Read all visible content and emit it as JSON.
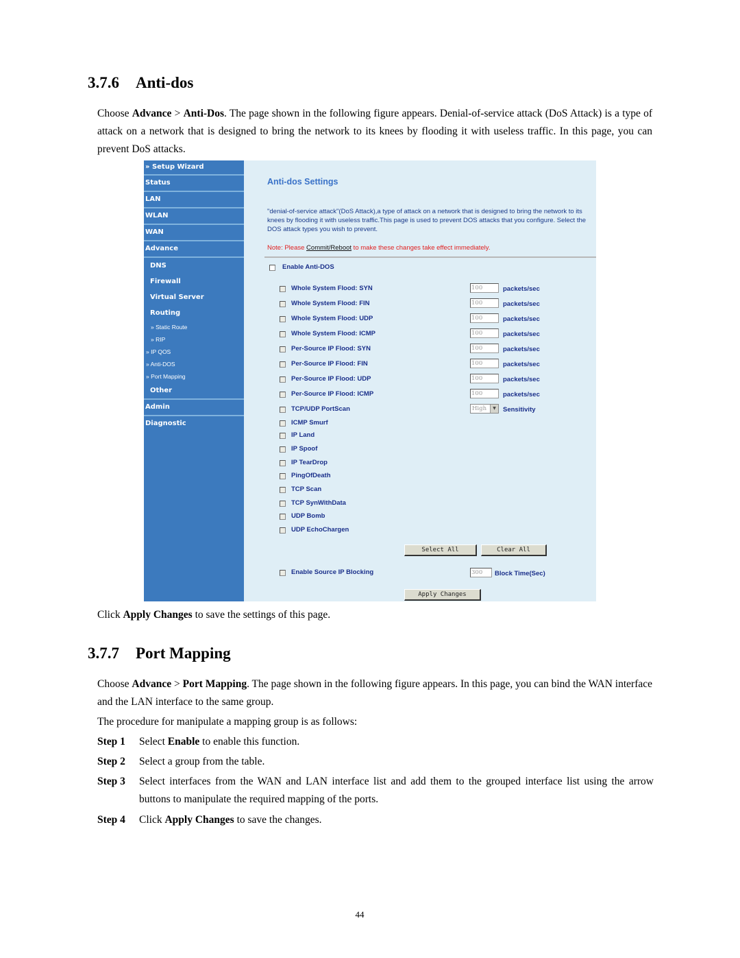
{
  "section1": {
    "number": "3.7.6",
    "title": "Anti-dos",
    "intro": {
      "pre": "Choose ",
      "b1": "Advance",
      "mid": " > ",
      "b2": "Anti-Dos",
      "post": ". The page shown in the following figure appears. Denial-of-service attack (DoS Attack) is a type of attack on a network that is designed to bring the network to its knees by flooding it with useless traffic. In this page, you can prevent DoS attacks."
    },
    "after": {
      "pre": "Click ",
      "b": "Apply Changes",
      "post": " to save the settings of this page."
    }
  },
  "figure": {
    "sidebar": {
      "items": [
        {
          "label": "» Setup Wizard"
        },
        {
          "label": "Status"
        },
        {
          "label": "LAN"
        },
        {
          "label": "WLAN"
        },
        {
          "label": "WAN"
        },
        {
          "label": "Advance"
        }
      ],
      "advance_sub": [
        {
          "label": "DNS"
        },
        {
          "label": "Firewall"
        },
        {
          "label": "Virtual Server"
        },
        {
          "label": "Routing"
        }
      ],
      "routing_sub": [
        {
          "label": "» Static Route"
        },
        {
          "label": "» RIP"
        }
      ],
      "advance_links": [
        {
          "label": "» IP QOS"
        },
        {
          "label": "» Anti-DOS"
        },
        {
          "label": "» Port Mapping"
        }
      ],
      "other": "Other",
      "bottom_items": [
        {
          "label": "Admin"
        },
        {
          "label": "Diagnostic"
        }
      ]
    },
    "content": {
      "title": "Anti-dos Settings",
      "description": "\"denial-of-service attack\"(DoS Attack),a type of attack on a network that is designed to bring the network to its knees by flooding it with useless traffic.This page is used to prevent DOS attacks that you configure. Select the DOS attack types you wish to prevent.",
      "note_pre": "Note: Please ",
      "note_link": "Commit/Reboot",
      "note_post": " to make these changes take effect immediately.",
      "enable_label": "Enable Anti-DOS",
      "enable_checked": false,
      "threshold_rows": [
        {
          "label": "Whole System Flood: SYN",
          "value": "100",
          "unit": "packets/sec"
        },
        {
          "label": "Whole System Flood: FIN",
          "value": "100",
          "unit": "packets/sec"
        },
        {
          "label": "Whole System Flood: UDP",
          "value": "100",
          "unit": "packets/sec"
        },
        {
          "label": "Whole System Flood: ICMP",
          "value": "100",
          "unit": "packets/sec"
        },
        {
          "label": "Per-Source IP Flood: SYN",
          "value": "100",
          "unit": "packets/sec"
        },
        {
          "label": "Per-Source IP Flood: FIN",
          "value": "100",
          "unit": "packets/sec"
        },
        {
          "label": "Per-Source IP Flood: UDP",
          "value": "100",
          "unit": "packets/sec"
        },
        {
          "label": "Per-Source IP Flood: ICMP",
          "value": "100",
          "unit": "packets/sec"
        }
      ],
      "portscan": {
        "label": "TCP/UDP PortScan",
        "selected": "High",
        "unit": "Sensitivity"
      },
      "simple_rows": [
        {
          "label": "ICMP Smurf"
        },
        {
          "label": "IP Land"
        },
        {
          "label": "IP Spoof"
        },
        {
          "label": "IP TearDrop"
        },
        {
          "label": "PingOfDeath"
        },
        {
          "label": "TCP Scan"
        },
        {
          "label": "TCP SynWithData"
        },
        {
          "label": "UDP Bomb"
        },
        {
          "label": "UDP EchoChargen"
        }
      ],
      "select_all": "Select All",
      "clear_all": "Clear All",
      "source_block": {
        "label": "Enable Source IP Blocking",
        "value": "300",
        "unit": "Block Time(Sec)"
      },
      "apply": "Apply Changes"
    }
  },
  "section2": {
    "number": "3.7.7",
    "title": "Port Mapping",
    "intro": {
      "pre": "Choose ",
      "b1": "Advance",
      "mid": " > ",
      "b2": "Port Mapping",
      "post": ". The page shown in the following figure appears. In this page, you can bind the WAN interface and the LAN interface to the same group."
    },
    "procedure": "The procedure for manipulate a mapping group is as follows:",
    "steps": [
      {
        "label": "Step 1",
        "pre": "Select ",
        "b": "Enable",
        "post": " to enable this function."
      },
      {
        "label": "Step 2",
        "pre": "Select a group from the table.",
        "b": "",
        "post": ""
      },
      {
        "label": "Step 3",
        "pre": "Select interfaces from the WAN and LAN interface list and add them to the grouped interface list using the arrow buttons to manipulate the required mapping of the ports.",
        "b": "",
        "post": ""
      },
      {
        "label": "Step 4",
        "pre": "Click ",
        "b": "Apply Changes",
        "post": " to save the changes."
      }
    ]
  },
  "page_number": "44"
}
